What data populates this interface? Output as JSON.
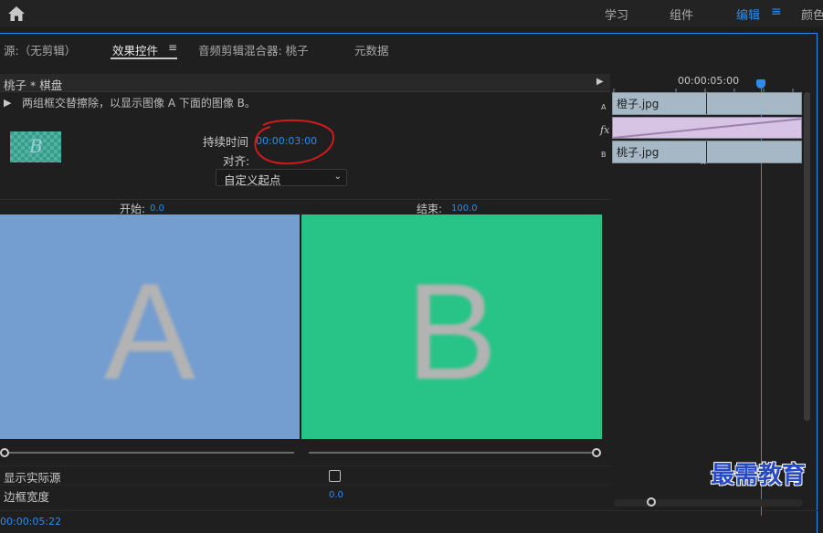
{
  "workspace": {
    "tabs": [
      "学习",
      "组件",
      "编辑",
      "颜色"
    ],
    "active_tab": "编辑",
    "menu_icon": "hamburger-icon"
  },
  "panel": {
    "tabs": [
      "源:（无剪辑）",
      "效果控件",
      "音频剪辑混合器: 桃子",
      "元数据"
    ],
    "active_tab": "效果控件",
    "menu_glyph": "≡"
  },
  "effect": {
    "clip_title": "桃子 * 棋盘",
    "description": "两组框交替擦除，以显示图像 A 下面的图像 B。",
    "thumbnail_letter": "B",
    "duration_label": "持续时间",
    "duration_value": "00:00:03:00",
    "alignment_label": "对齐:",
    "alignment_value": "自定义起点",
    "start_label": "开始:",
    "start_value": "0.0",
    "end_label": "结束:",
    "end_value": "100.0",
    "preview_a_letter": "A",
    "preview_b_letter": "B",
    "preview_a_color": "#759ed0",
    "preview_b_color": "#28c487",
    "show_actual_sources_label": "显示实际源",
    "show_actual_sources_checked": false,
    "border_width_label": "边框宽度",
    "border_width_value": "0.0",
    "current_time": "00:00:05:22"
  },
  "timeline": {
    "ruler_time": "00:00:05:00",
    "track_a_label": "A",
    "track_b_label": "B",
    "fx_label": "fx",
    "clip_a_name": "橙子.jpg",
    "clip_b_name": "桃子.jpg"
  },
  "watermark": {
    "text": "最需教育"
  },
  "colors": {
    "accent": "#2d8ceb",
    "annotation": "#d11a1a"
  }
}
